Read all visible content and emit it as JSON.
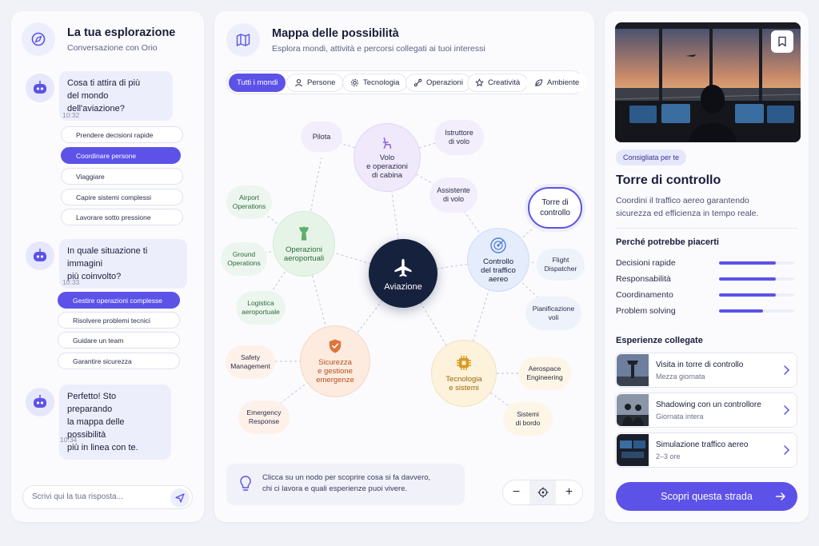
{
  "chat": {
    "title": "La tua esplorazione",
    "subtitle": "Conversazione con Orio",
    "messages": [
      {
        "text_line1": "Cosa ti attira di più",
        "text_line2": "del mondo dell'aviazione?",
        "time": "10:32"
      },
      {
        "text_line1": "In quale situazione ti immagini",
        "text_line2": "più coinvolto?",
        "time": "10:33"
      },
      {
        "text_line1": "Perfetto! Sto preparando",
        "text_line2": "la mappa delle possibilità",
        "text_line3": "più in linea con te.",
        "time": "10:34"
      }
    ],
    "options1": [
      "Prendere decisioni rapide",
      "Coordinare persone",
      "Viaggiare",
      "Capire sistemi complessi",
      "Lavorare sotto pressione"
    ],
    "options2": [
      "Gestire operazioni complesse",
      "Risolvere problemi tecnici",
      "Guidare un team",
      "Garantire sicurezza"
    ],
    "input_placeholder": "Scrivi qui la tua risposta..."
  },
  "map": {
    "title": "Mappa delle possibilità",
    "subtitle": "Esplora mondi, attività e percorsi collegati ai tuoi interessi",
    "filters": [
      "Tutti i mondi",
      "Persone",
      "Tecnologia",
      "Operazioni",
      "Creatività",
      "Ambiente"
    ],
    "center": "Aviazione",
    "hubs": {
      "volo": [
        "Volo",
        "e operazioni",
        "di cabina"
      ],
      "operazioni": [
        "Operazioni",
        "aeroportuali"
      ],
      "controllo": [
        "Controllo",
        "del traffico",
        "aereo"
      ],
      "sicurezza": [
        "Sicurezza",
        "e gestione",
        "emergenze"
      ],
      "tecnologia": [
        "Tecnologia",
        "e sistemi"
      ]
    },
    "leaves": {
      "pilota": [
        "Pilota"
      ],
      "istruttore": [
        "Istruttore",
        "di volo"
      ],
      "assistente": [
        "Assistente",
        "di volo"
      ],
      "airport_ops": [
        "Airport",
        "Operations"
      ],
      "ground_ops": [
        "Ground",
        "Operations"
      ],
      "logistica": [
        "Logistica",
        "aeroportuale"
      ],
      "torre": [
        "Torre di",
        "controllo"
      ],
      "flight_dispatcher": [
        "Flight",
        "Dispatcher"
      ],
      "pianificazione": [
        "Pianificazione",
        "voli"
      ],
      "safety": [
        "Safety",
        "Management"
      ],
      "emergency": [
        "Emergency",
        "Response"
      ],
      "aerospace": [
        "Aerospace",
        "Engineering"
      ],
      "sistemi_bordo": [
        "Sistemi",
        "di bordo"
      ]
    },
    "hint_line1": "Clicca su un nodo per scoprire cosa si fa davvero,",
    "hint_line2": "chi ci lavora e quali esperienze puoi vivere.",
    "zoom_out": "−",
    "zoom_in": "+"
  },
  "detail": {
    "badge": "Consigliata per te",
    "title": "Torre di controllo",
    "desc_line1": "Coordini il traffico aereo garantendo",
    "desc_line2": "sicurezza ed efficienza in tempo reale.",
    "why_title": "Perché potrebbe piacerti",
    "traits": [
      {
        "label": "Decisioni rapide",
        "level": 0.76
      },
      {
        "label": "Responsabilità",
        "level": 0.76
      },
      {
        "label": "Coordinamento",
        "level": 0.76
      },
      {
        "label": "Problem solving",
        "level": 0.59
      }
    ],
    "exp_title": "Esperienze collegate",
    "experiences": [
      {
        "title": "Visita in torre di controllo",
        "duration": "Mezza giornata"
      },
      {
        "title": "Shadowing con un controllore",
        "duration": "Giornata intera"
      },
      {
        "title": "Simulazione traffico aereo",
        "duration": "2–3 ore"
      }
    ],
    "cta": "Scopri questa strada"
  },
  "colors": {
    "accent": "#5c52e8",
    "center_node": "#16213e",
    "volo": "#a58ae0",
    "operazioni": "#5fae6e",
    "controllo": "#4f7fd9",
    "sicurezza": "#e0743a",
    "tecnologia": "#d99a1f"
  }
}
